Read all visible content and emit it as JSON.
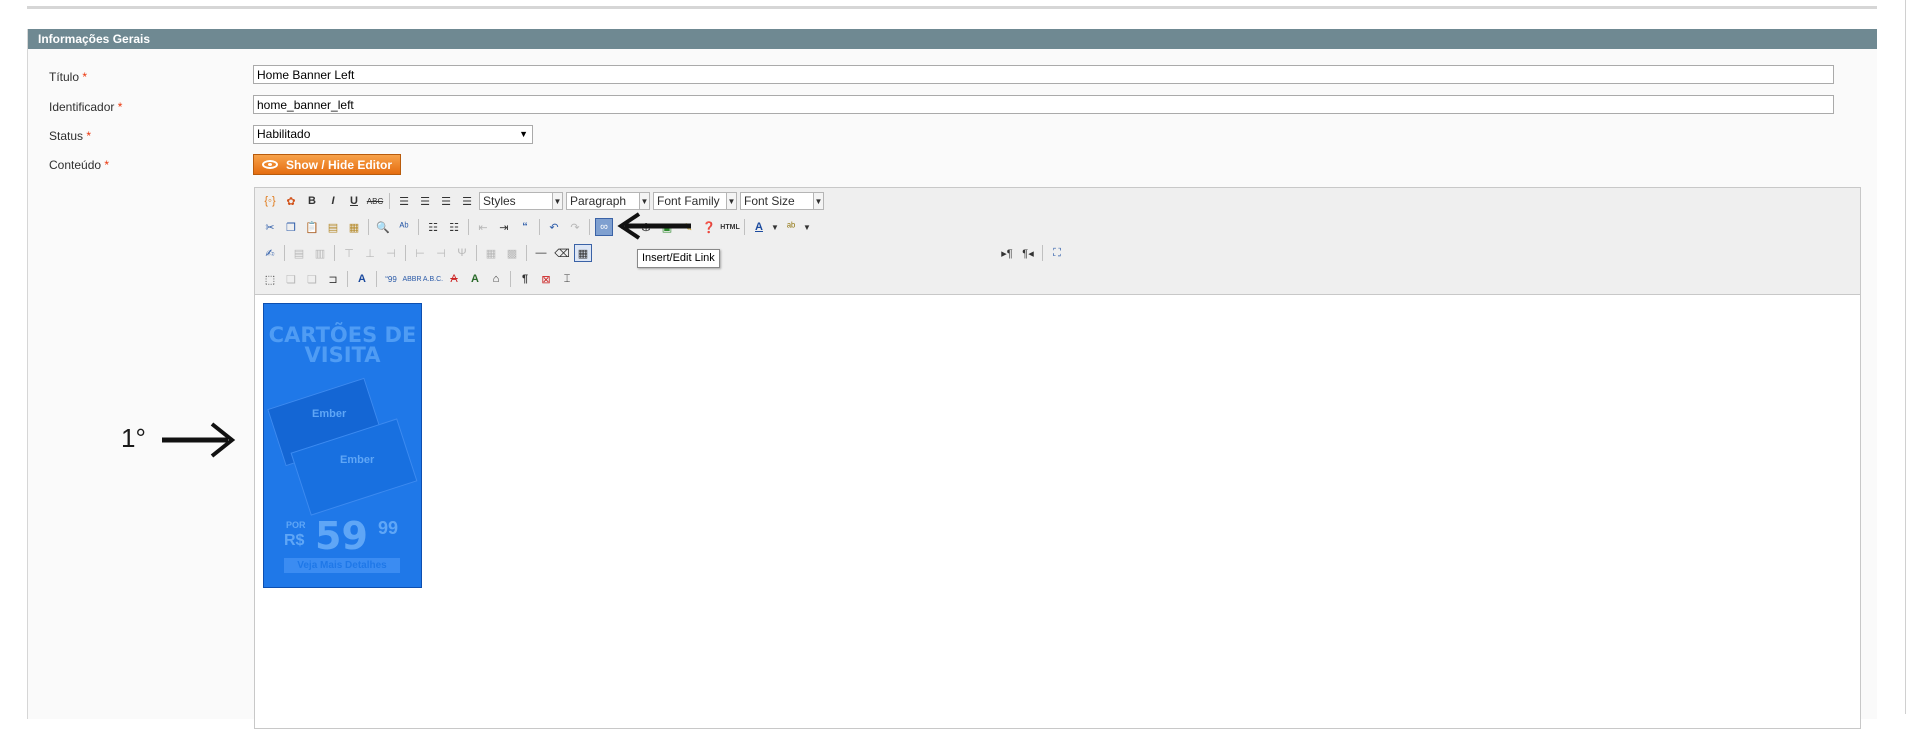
{
  "panel": {
    "title": "Informações Gerais"
  },
  "form": {
    "titulo_label": "Título",
    "titulo_value": "Home Banner Left",
    "identificador_label": "Identificador",
    "identificador_value": "home_banner_left",
    "status_label": "Status",
    "status_value": "Habilitado",
    "conteudo_label": "Conteúdo",
    "required_mark": "*",
    "editor_toggle_label": "Show / Hide Editor"
  },
  "toolbar": {
    "styles": "Styles",
    "paragraph": "Paragraph",
    "font_family": "Font Family",
    "font_size": "Font Size",
    "tooltip": "Insert/Edit Link"
  },
  "banner": {
    "title_line1": "CARTÕES DE",
    "title_line2": "VISITA",
    "logo": "Ember",
    "por": "POR",
    "currency": "R$",
    "price": "59",
    "cents": "99",
    "button": "Veja Mais Detalhes"
  },
  "annotation": {
    "step": "1°"
  },
  "colors": {
    "panel_header": "#6f8992",
    "button_orange": "#e56d10",
    "banner_blue": "#1f78e8",
    "required": "#eb340a"
  }
}
